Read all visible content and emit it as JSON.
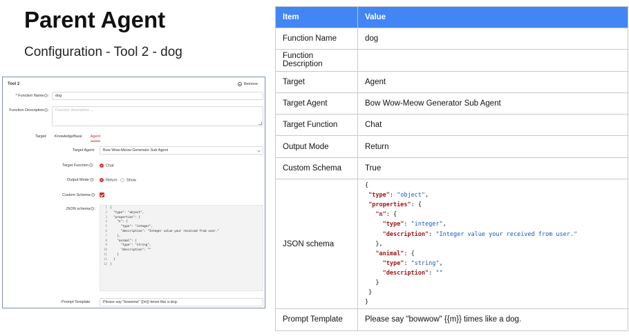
{
  "slide": {
    "title": "Parent Agent",
    "subtitle": "Configuration - Tool 2 - dog"
  },
  "form": {
    "heading": "Tool 2",
    "remove_label": "Remove",
    "function_name_label": "* Function Name",
    "function_name_value": "dog",
    "function_description_label": "Function Description",
    "function_description_placeholder": "Function description ...",
    "target_label": "Target:",
    "target_tabs": [
      "KnowledgeBase",
      "Agent"
    ],
    "target_agent_label": "Target Agent:",
    "target_agent_value": "Bow Wow-Meow Generator Sub Agent",
    "target_function_label": "Target Function",
    "target_function_option": "Chat",
    "output_mode_label": "Output Mode",
    "output_mode_options": [
      "Return",
      "Show"
    ],
    "custom_schema_label": "Custom Schema",
    "json_schema_label": "JSON schema",
    "json_lines": [
      "{",
      "  \"type\": \"object\",",
      "  \"properties\": {",
      "    \"n\": {",
      "      \"type\": \"integer\",",
      "      \"description\": \"Integer value your received from user.\"",
      "    },",
      "    \"animal\": {",
      "      \"type\": \"string\",",
      "      \"description\": \"\"",
      "    }",
      "  }",
      "}"
    ],
    "prompt_template_label": "Prompt Template",
    "prompt_template_value": "Please say \"bowwow\" {{m}} times like a dog."
  },
  "table": {
    "headers": [
      "Item",
      "Value"
    ],
    "rows": [
      {
        "item": "Function Name",
        "value": "dog"
      },
      {
        "item": "Function Description",
        "value": ""
      },
      {
        "item": "Target",
        "value": "Agent"
      },
      {
        "item": "Target Agent",
        "value": "Bow Wow-Meow Generator Sub Agent"
      },
      {
        "item": "Target Function",
        "value": "Chat"
      },
      {
        "item": "Output Mode",
        "value": "Return"
      },
      {
        "item": "Custom Schema",
        "value": "True"
      },
      {
        "item": "JSON schema",
        "value": ""
      },
      {
        "item": "Prompt Template",
        "value": "Please say \"bowwow\" {{m}} times like a dog."
      }
    ],
    "json_lines": [
      "{",
      " \"type\": \"object\",",
      " \"properties\": {",
      "   \"n\": {",
      "     \"type\": \"integer\",",
      "     \"description\": \"Integer value your received from user.\"",
      "   },",
      "   \"animal\": {",
      "     \"type\": \"string\",",
      "     \"description\": \"\"",
      "   }",
      " }",
      "}"
    ]
  },
  "colors": {
    "header_blue": "#4285f4",
    "accent_red": "#c4302b",
    "json_key": "#a31515",
    "json_string": "#1a56c2"
  }
}
